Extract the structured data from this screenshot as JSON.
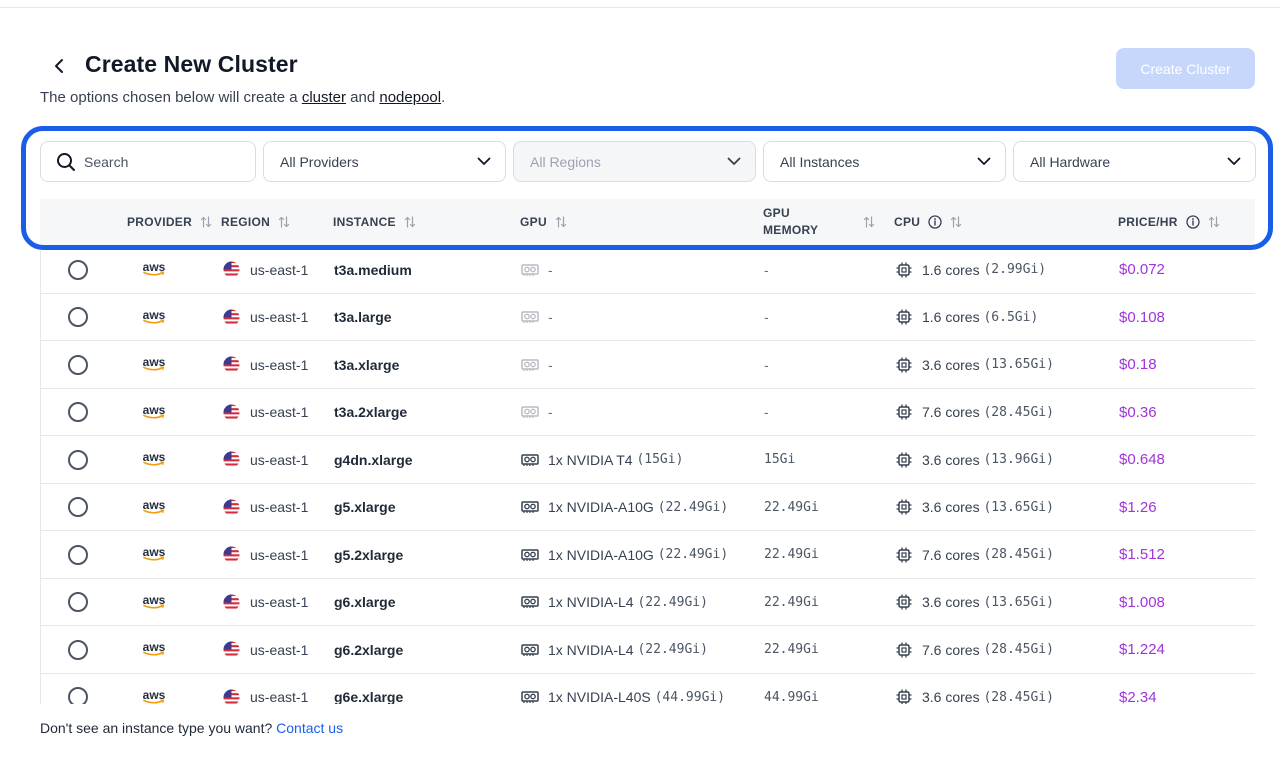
{
  "header": {
    "title": "Create New Cluster",
    "subtitle_pre": "The options chosen below will create a ",
    "subtitle_link1": "cluster",
    "subtitle_mid": " and ",
    "subtitle_link2": "nodepool",
    "subtitle_post": ".",
    "create_button": "Create Cluster"
  },
  "filters": {
    "search_placeholder": "Search",
    "providers": "All Providers",
    "regions": "All Regions",
    "instances": "All Instances",
    "hardware": "All Hardware"
  },
  "columns": {
    "provider": "PROVIDER",
    "region": "REGION",
    "instance": "INSTANCE",
    "gpu": "GPU",
    "gpu_memory_1": "GPU",
    "gpu_memory_2": "MEMORY",
    "cpu": "CPU",
    "price": "PRICE/HR"
  },
  "rows": [
    {
      "provider": "aws",
      "region": "us-east-1",
      "instance": "t3a.medium",
      "gpu": "-",
      "gpu_memory": "-",
      "cores": "1.6 cores",
      "mem": "(2.99Gi)",
      "price": "$0.072",
      "has_gpu": false
    },
    {
      "provider": "aws",
      "region": "us-east-1",
      "instance": "t3a.large",
      "gpu": "-",
      "gpu_memory": "-",
      "cores": "1.6 cores",
      "mem": "(6.5Gi)",
      "price": "$0.108",
      "has_gpu": false
    },
    {
      "provider": "aws",
      "region": "us-east-1",
      "instance": "t3a.xlarge",
      "gpu": "-",
      "gpu_memory": "-",
      "cores": "3.6 cores",
      "mem": "(13.65Gi)",
      "price": "$0.18",
      "has_gpu": false
    },
    {
      "provider": "aws",
      "region": "us-east-1",
      "instance": "t3a.2xlarge",
      "gpu": "-",
      "gpu_memory": "-",
      "cores": "7.6 cores",
      "mem": "(28.45Gi)",
      "price": "$0.36",
      "has_gpu": false
    },
    {
      "provider": "aws",
      "region": "us-east-1",
      "instance": "g4dn.xlarge",
      "gpu": "1x NVIDIA T4",
      "gpu_mem_paren": "(15Gi)",
      "gpu_memory": "15Gi",
      "cores": "3.6 cores",
      "mem": "(13.96Gi)",
      "price": "$0.648",
      "has_gpu": true
    },
    {
      "provider": "aws",
      "region": "us-east-1",
      "instance": "g5.xlarge",
      "gpu": "1x NVIDIA-A10G",
      "gpu_mem_paren": "(22.49Gi)",
      "gpu_memory": "22.49Gi",
      "cores": "3.6 cores",
      "mem": "(13.65Gi)",
      "price": "$1.26",
      "has_gpu": true
    },
    {
      "provider": "aws",
      "region": "us-east-1",
      "instance": "g5.2xlarge",
      "gpu": "1x NVIDIA-A10G",
      "gpu_mem_paren": "(22.49Gi)",
      "gpu_memory": "22.49Gi",
      "cores": "7.6 cores",
      "mem": "(28.45Gi)",
      "price": "$1.512",
      "has_gpu": true
    },
    {
      "provider": "aws",
      "region": "us-east-1",
      "instance": "g6.xlarge",
      "gpu": "1x NVIDIA-L4",
      "gpu_mem_paren": "(22.49Gi)",
      "gpu_memory": "22.49Gi",
      "cores": "3.6 cores",
      "mem": "(13.65Gi)",
      "price": "$1.008",
      "has_gpu": true
    },
    {
      "provider": "aws",
      "region": "us-east-1",
      "instance": "g6.2xlarge",
      "gpu": "1x NVIDIA-L4",
      "gpu_mem_paren": "(22.49Gi)",
      "gpu_memory": "22.49Gi",
      "cores": "7.6 cores",
      "mem": "(28.45Gi)",
      "price": "$1.224",
      "has_gpu": true
    },
    {
      "provider": "aws",
      "region": "us-east-1",
      "instance": "g6e.xlarge",
      "gpu": "1x NVIDIA-L40S",
      "gpu_mem_paren": "(44.99Gi)",
      "gpu_memory": "44.99Gi",
      "cores": "3.6 cores",
      "mem": "(28.45Gi)",
      "price": "$2.34",
      "has_gpu": true
    }
  ],
  "footer": {
    "text": "Don't see an instance type you want? ",
    "link": "Contact us"
  },
  "colors": {
    "accent": "#1a5ee8",
    "price": "#a033d9",
    "create_disabled": "#c7d7fb"
  }
}
